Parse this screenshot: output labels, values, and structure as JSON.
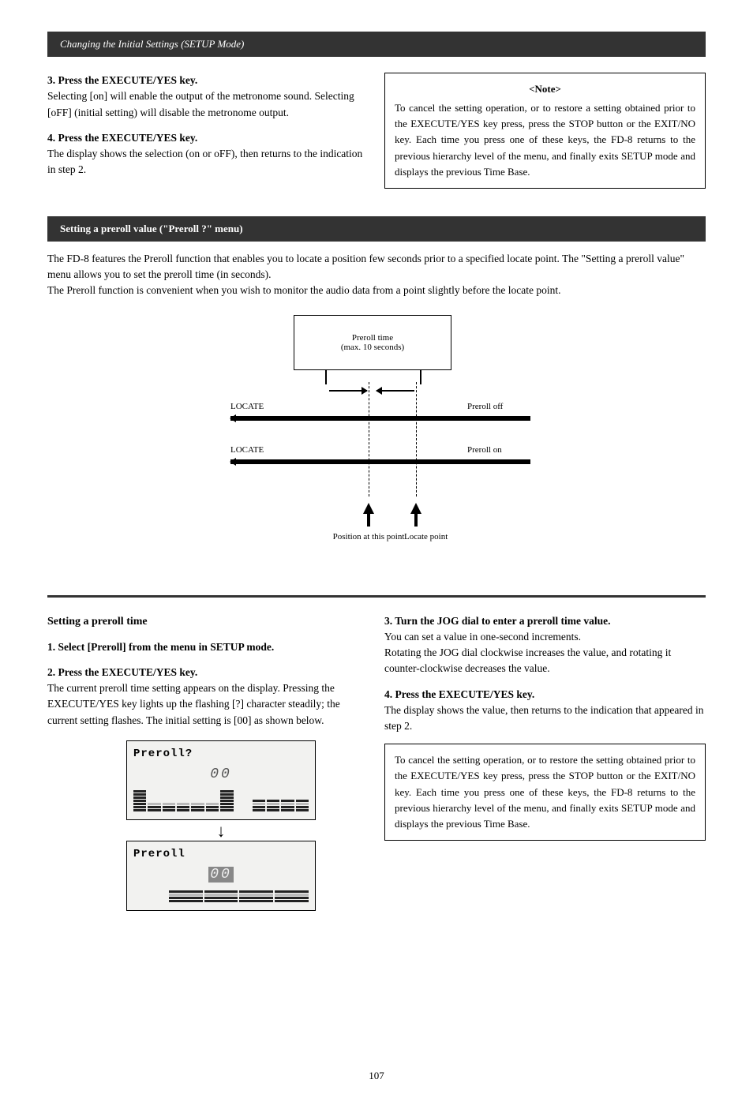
{
  "header_text": "Changing the Initial Settings (SETUP Mode)",
  "section1": {
    "step3_head": "3. Press the EXECUTE/YES key.",
    "step3_body": "Selecting [on] will enable the output of the metronome sound. Selecting [oFF] (initial setting) will disable the metronome output.",
    "step4_head": "4. Press the EXECUTE/YES key.",
    "step4_body": "The display shows the selection (on or oFF), then returns to the indication in step 2.",
    "note_title": "<Note>",
    "note_body": "To cancel the setting operation, or to restore a setting obtained prior to the EXECUTE/YES key press, press the STOP button or the EXIT/NO key. Each time you press one of these keys, the FD-8 returns to the previous hierarchy level of the menu, and finally exits SETUP mode and displays the previous Time Base."
  },
  "section2": {
    "title": "Setting a preroll value (\"Preroll ?\" menu)",
    "intro": "The FD-8 features the Preroll function that enables you to locate a position few seconds prior to a specified locate point. The \"Setting a preroll value\" menu allows you to set the preroll time (in seconds).\nThe Preroll function is convenient when you wish to monitor the audio data from a point slightly before the locate point.",
    "diagram": {
      "box_label": "Preroll time\n(max. 10 seconds)",
      "locate_bar": "LOCATE",
      "preroll_on": "Preroll on",
      "preroll_off": "Preroll off",
      "position_pt": "Position at this point",
      "locate_pt": "Locate point"
    }
  },
  "section3": {
    "heading": "Setting a preroll time",
    "step1_head": "1. Select [Preroll] from the menu in SETUP mode.",
    "step2_head": "2. Press the EXECUTE/YES key.",
    "step2_body": "The current preroll time setting appears on the display. Pressing the EXECUTE/YES key lights up the flashing [?] character steadily; the current setting flashes. The initial setting is [00] as shown below.",
    "lcd1_title": "Preroll?",
    "lcd1_digits": "00",
    "lcd2_title": "Preroll",
    "lcd2_digits": "00",
    "step3_head": "3. Turn the JOG dial to enter a preroll time value.",
    "step3_body": "You can set a value in one-second increments.\nRotating the JOG dial clockwise increases the value, and rotating it counter-clockwise decreases the value.",
    "step4_head": "4. Press the EXECUTE/YES key.",
    "step4_body": "The display shows the value, then returns to the indication that appeared in step 2.",
    "note_body": "To cancel the setting operation, or to restore the setting obtained prior to the EXECUTE/YES key press, press the STOP button or the EXIT/NO key. Each time you press one of these keys, the FD-8 returns to the previous hierarchy level of the menu, and finally exits SETUP mode and displays the previous Time Base."
  },
  "page_number": "107"
}
